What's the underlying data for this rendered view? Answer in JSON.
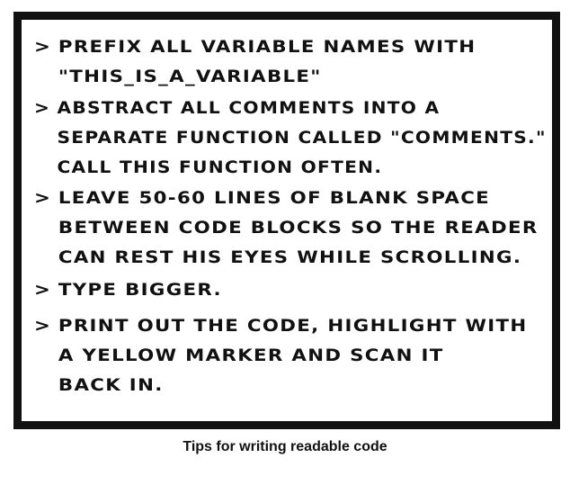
{
  "bullet": ">",
  "tips": [
    {
      "lines": [
        "PREFIX ALL VARIABLE NAMES WITH",
        "\"THIS_IS_A_VARIABLE\""
      ]
    },
    {
      "lines": [
        "ABSTRACT ALL COMMENTS INTO A",
        "SEPARATE FUNCTION CALLED \"COMMENTS.\"",
        "CALL THIS FUNCTION OFTEN."
      ]
    },
    {
      "lines": [
        "LEAVE 50-60 LINES OF BLANK SPACE",
        "BETWEEN CODE BLOCKS SO THE READER",
        "CAN REST HIS EYES WHILE SCROLLING."
      ]
    },
    {
      "lines": [
        "TYPE BIGGER."
      ]
    },
    {
      "lines": [
        "PRINT OUT THE CODE, HIGHLIGHT WITH",
        "A YELLOW MARKER AND SCAN IT",
        "BACK IN."
      ]
    }
  ],
  "caption": "Tips for writing readable code"
}
